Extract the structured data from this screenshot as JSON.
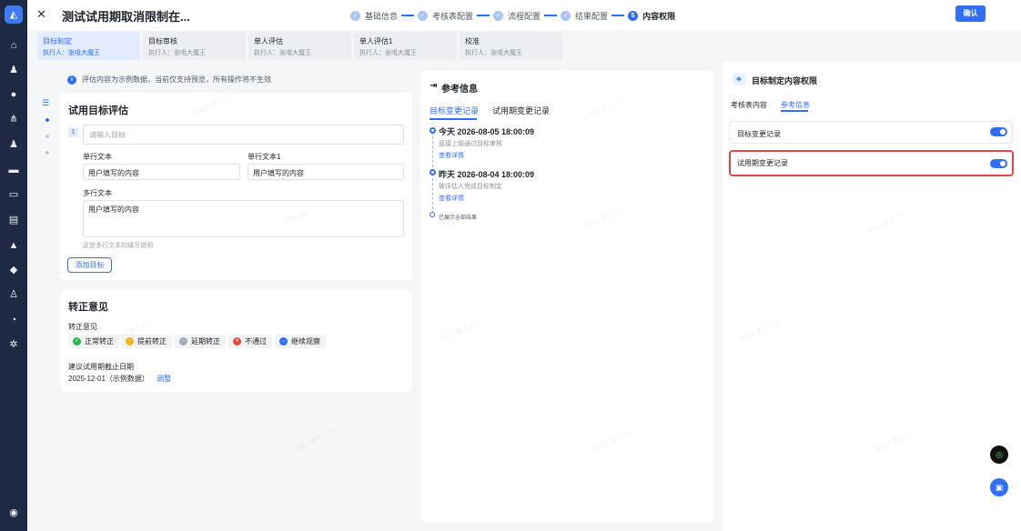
{
  "header": {
    "close_icon": "✕",
    "title": "测试试用期取消限制在...",
    "steps": [
      {
        "label": "基础信息",
        "mark": "✓",
        "state": "done"
      },
      {
        "label": "考核表配置",
        "mark": "✓",
        "state": "done"
      },
      {
        "label": "流程配置",
        "mark": "✓",
        "state": "done"
      },
      {
        "label": "结果配置",
        "mark": "✓",
        "state": "done"
      },
      {
        "label": "内容权限",
        "mark": "5",
        "state": "active"
      }
    ],
    "confirm_label": "确认"
  },
  "stage_tabs": [
    {
      "name": "目标制定",
      "executor": "执行人：张咀大魔王"
    },
    {
      "name": "目标审核",
      "executor": "执行人：张咀大魔王"
    },
    {
      "name": "单人评估",
      "executor": "执行人：张咀大魔王"
    },
    {
      "name": "单人评估1",
      "executor": "执行人：张咀大魔王"
    },
    {
      "name": "校准",
      "executor": "执行人：张咀大魔王"
    }
  ],
  "notice": "评估内容为示例数据，当前仅支持预览，所有操作将不生效",
  "form": {
    "card_title": "试用目标评估",
    "target_index": "1",
    "target_placeholder": "请输入目标",
    "single_text_label": "单行文本",
    "single_text_value": "用户填写的内容",
    "single_text1_label": "单行文本1",
    "single_text1_value": "用户填写的内容",
    "multi_text_label": "多行文本",
    "multi_text_value": "用户填写的内容",
    "multi_text_hint": "这是多行文本的填写说明",
    "add_target_label": "添加目标"
  },
  "regularization": {
    "card_title": "转正意见",
    "opinion_label": "转正意见",
    "options": [
      {
        "label": "正常转正",
        "color": "#2db84d",
        "mark": "✓"
      },
      {
        "label": "提前转正",
        "color": "#f5b319",
        "mark": "↑"
      },
      {
        "label": "延期转正",
        "color": "#a4aab5",
        "mark": "−"
      },
      {
        "label": "不通过",
        "color": "#e8463c",
        "mark": "✕"
      },
      {
        "label": "继续观察",
        "color": "#2f6ef6",
        "mark": "→"
      }
    ],
    "deadline_label": "建议试用期截止日期",
    "deadline_value": "2025-12-01（示例数据）",
    "adjust_label": "调整"
  },
  "reference": {
    "title": "参考信息",
    "tabs": [
      "目标变更记录",
      "试用期变更记录"
    ],
    "timeline": [
      {
        "time": "今天 2026-08-05 18:00:09",
        "desc": "直接上级通过目标审核",
        "link": "查看详情"
      },
      {
        "time": "昨天 2026-08-04 18:00:09",
        "desc": "被评估人完成目标制定",
        "link": "查看详情"
      }
    ],
    "end_text": "已展示全部结果"
  },
  "permissions_panel": {
    "title": "目标制定内容权限",
    "tabs": [
      "考核表内容",
      "参考信息"
    ],
    "items": [
      {
        "label": "目标变更记录",
        "enabled": true
      },
      {
        "label": "试用期变更记录",
        "enabled": true
      }
    ]
  },
  "watermark": "张咀大魔王 777",
  "accent_color": "#2f6ef6"
}
